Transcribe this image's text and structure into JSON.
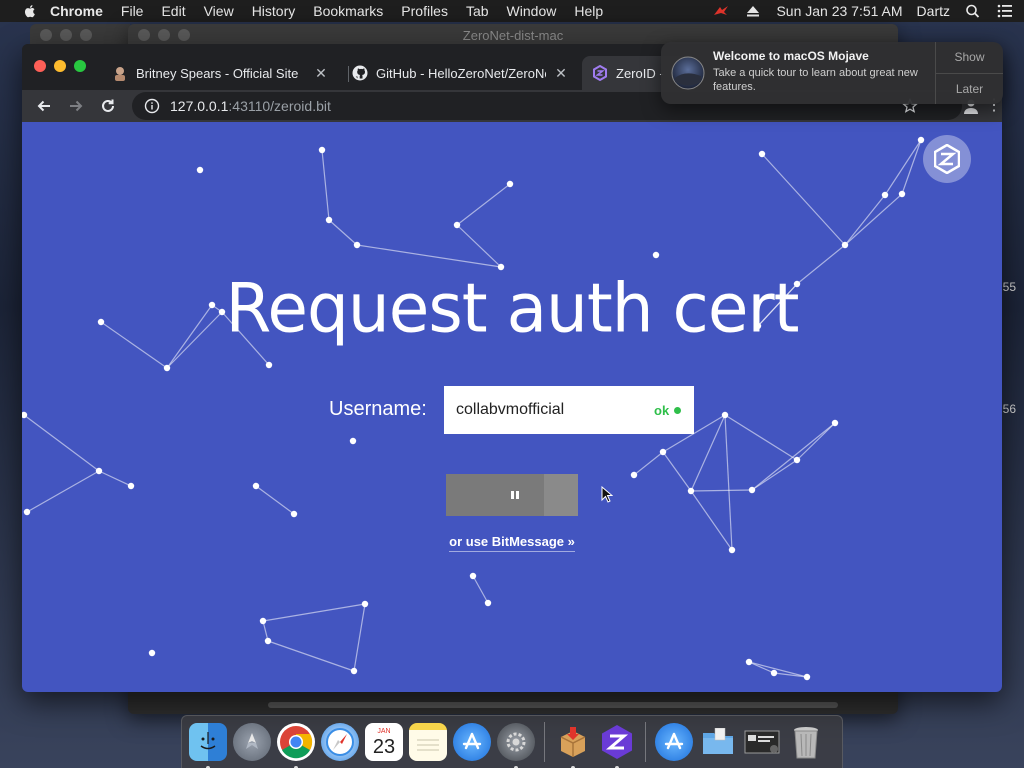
{
  "menubar": {
    "app_name": "Chrome",
    "menus": [
      "File",
      "Edit",
      "View",
      "History",
      "Bookmarks",
      "Profiles",
      "Tab",
      "Window",
      "Help"
    ],
    "clock": "Sun Jan 23  7:51 AM",
    "user": "Dartz"
  },
  "background_window": {
    "title": "ZeroNet-dist-mac"
  },
  "browser": {
    "tabs": [
      {
        "label": "Britney Spears - Official Site",
        "icon": "britney-favicon-icon"
      },
      {
        "label": "GitHub - HelloZeroNet/ZeroNe",
        "icon": "github-icon"
      },
      {
        "label": "ZeroID -",
        "icon": "zeroid-icon"
      }
    ],
    "url_host": "127.0.0.1",
    "url_rest": ":43110/zeroid.bit"
  },
  "page": {
    "headline": "Request auth cert",
    "username_label": "Username:",
    "username_value": "collabvmofficial",
    "status_text": "ok",
    "progress_fraction": 0.74,
    "alt_link": "or use BitMessage »",
    "accent": "#4355c0",
    "ok_color": "#2fbf4a"
  },
  "notification": {
    "title": "Welcome to macOS Mojave",
    "text": "Take a quick tour to learn about great new features.",
    "show_label": "Show",
    "later_label": "Later"
  },
  "side_text": {
    "top": "55",
    "bottom": "56"
  },
  "dock": {
    "items": [
      "finder-icon",
      "launchpad-icon",
      "chrome-icon",
      "safari-icon",
      "calendar-icon",
      "notes-icon",
      "app-store-icon",
      "system-preferences-icon",
      "installer-icon",
      "zeronet-icon",
      "app-store-folder-icon",
      "folder-icon",
      "screenshot-icon",
      "trash-icon"
    ],
    "calendar_month": "JAN",
    "calendar_day": "23"
  }
}
